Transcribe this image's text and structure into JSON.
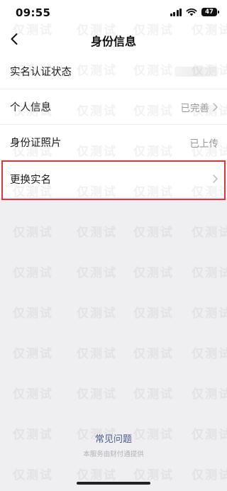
{
  "status_bar": {
    "time": "09:55",
    "battery": "47"
  },
  "nav": {
    "title": "身份信息",
    "back_icon": "chevron-left-icon"
  },
  "rows": [
    {
      "label": "实名认证状态",
      "value": ""
    },
    {
      "label": "个人信息",
      "value": "已完善"
    },
    {
      "label": "身份证照片",
      "value": "已上传"
    },
    {
      "label": "更换实名",
      "value": ""
    }
  ],
  "footer": {
    "faq": "常见问题",
    "provider": "本服务由财付通提供"
  },
  "watermark": {
    "text": "仅测试"
  },
  "colors": {
    "highlight": "#e0343d",
    "link": "#4a5d8c",
    "background": "#efeff2"
  }
}
